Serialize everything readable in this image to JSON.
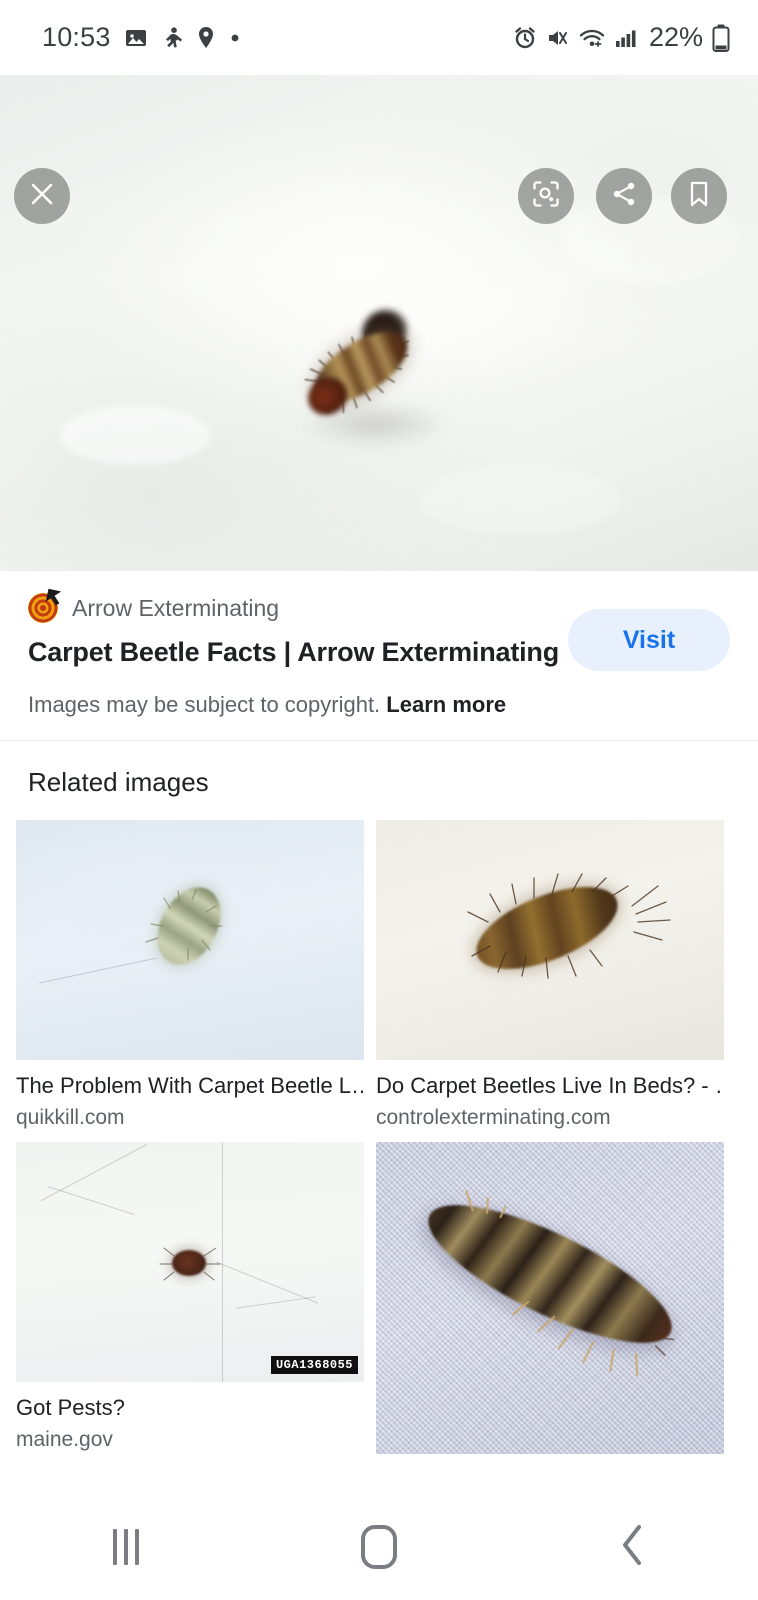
{
  "statusbar": {
    "time": "10:53",
    "battery_percent": "22%",
    "left_icons": [
      "image-icon",
      "running-person-icon",
      "location-pin-icon",
      "dot-icon"
    ],
    "right_icons": [
      "alarm-icon",
      "mute-vibrate-icon",
      "wifi-icon",
      "cellular-signal-icon"
    ],
    "color": "#3c4043"
  },
  "hero": {
    "alt": "carpet beetle larva on white fabric",
    "buttons": {
      "close": "close-icon",
      "lens": "google-lens-icon",
      "share": "share-icon",
      "save": "bookmark-icon"
    }
  },
  "result": {
    "favicon": "arrow-exterminating-target-logo",
    "source": "Arrow Exterminating",
    "title": "Carpet Beetle Facts | Arrow Exterminating",
    "copyright_text": "Images may be subject to copyright.",
    "copyright_link": "Learn more",
    "visit_label": "Visit",
    "visit_bg": "#e8f0fe",
    "visit_color": "#1a73e8"
  },
  "related": {
    "heading": "Related images",
    "items": [
      {
        "title": "The Problem With Carpet Beetle L…",
        "site": "quikkill.com",
        "alt": "pale carpet beetle larva on light blue fabric"
      },
      {
        "title": "Do Carpet Beetles Live In Beds? - …",
        "site": "controlexterminating.com",
        "alt": "hairy brown carpet beetle larva on cream background"
      },
      {
        "title": "Got Pests?",
        "site": "maine.gov",
        "alt": "small dark carpet beetle on white paper",
        "watermark": "UGA1368055"
      },
      {
        "title": "",
        "site": "",
        "alt": "dark banded carpet beetle larva on lavender woven fabric"
      }
    ]
  },
  "navbar": {
    "recents": "recents-icon",
    "home": "home-icon",
    "back": "back-icon",
    "color": "#7a7d82"
  }
}
